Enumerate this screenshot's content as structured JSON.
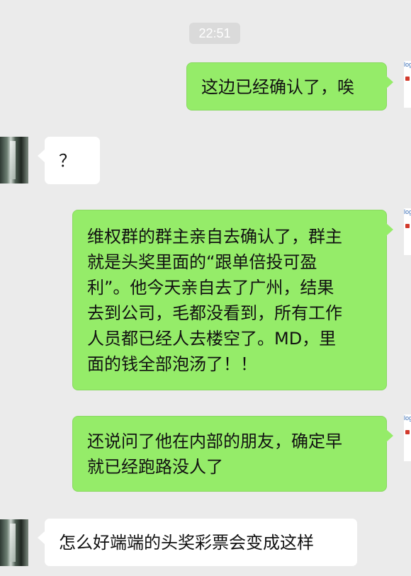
{
  "chat": {
    "timestamp": "22:51",
    "messages": [
      {
        "side": "out",
        "text": "这边已经确认了，唉"
      },
      {
        "side": "in",
        "text": "？"
      },
      {
        "side": "out",
        "text": "维权群的群主亲自去确认了，群主\n就是头奖里面的“跟单倍投可盈\n利”。他今天亲自去了广州，结果\n去到公司，毛都没看到，所有工作\n人员都已经人去楼空了。MD，里\n面的钱全部泡汤了！！"
      },
      {
        "side": "out",
        "text": "还说问了他在内部的朋友，确定早\n就已经跑路没人了"
      },
      {
        "side": "in",
        "text": "怎么好端端的头奖彩票会变成这样"
      }
    ]
  },
  "avatars": {
    "self_fragment_text": "log"
  },
  "colors": {
    "background": "#ebebeb",
    "outgoing_bubble": "#95ec69",
    "incoming_bubble": "#ffffff",
    "timestamp_bg": "#dadada"
  }
}
